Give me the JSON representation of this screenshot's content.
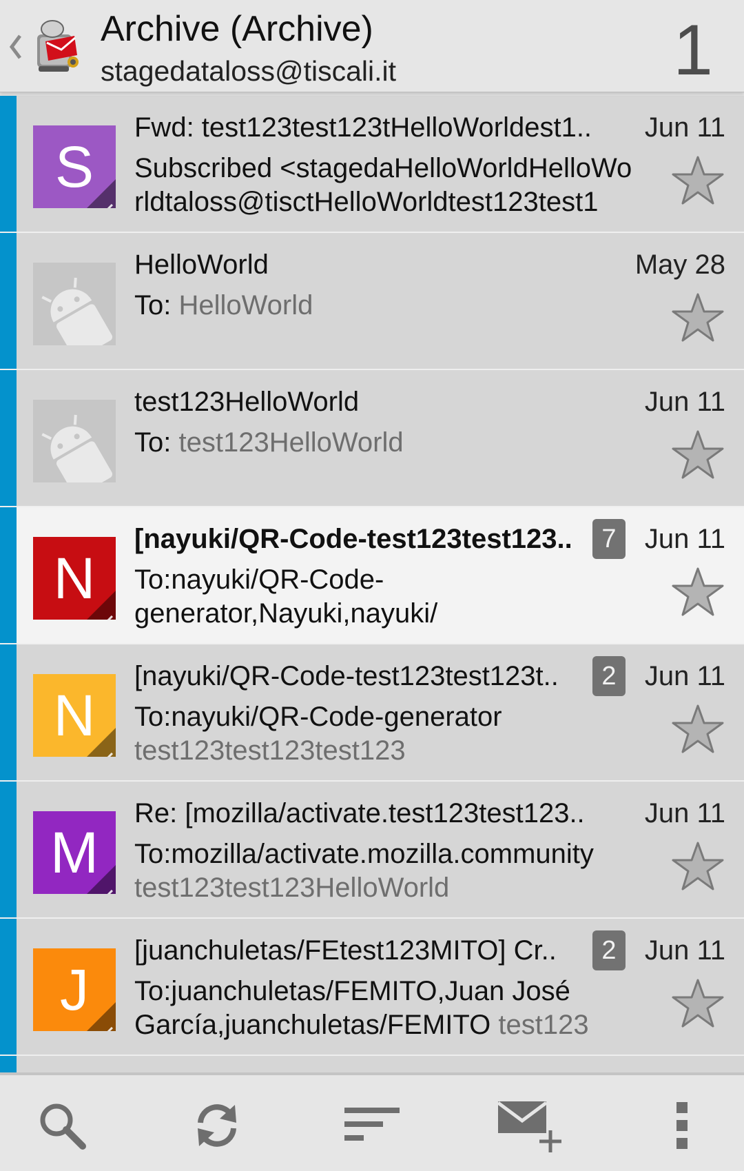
{
  "header": {
    "title": "Archive (Archive)",
    "account": "stagedataloss@tiscali.it",
    "unread_count": "1",
    "back_icon": "chevron-left-icon",
    "logo_icon": "k9-mail-logo"
  },
  "messages": [
    {
      "avatar_letter": "S",
      "avatar_color": "#9c58c4",
      "subject": "Fwd: test123test123tHelloWorldest1..",
      "date": "Jun 11",
      "preview_line1": "Subscribed <stagedaHelloWorldHelloWo",
      "preview_line2": "rldtaloss@tisctHelloWorldtest123test1",
      "starred": false
    },
    {
      "avatar_letter": "",
      "avatar_color": "#c6c6c6",
      "subject": "HelloWorld",
      "date": "May 28",
      "to_label": "To: ",
      "to_value": "HelloWorld",
      "starred": false
    },
    {
      "avatar_letter": "",
      "avatar_color": "#c6c6c6",
      "subject": "test123HelloWorld",
      "date": "Jun 11",
      "to_label": "To: ",
      "to_value": "test123HelloWorld",
      "starred": false
    },
    {
      "avatar_letter": "N",
      "avatar_color": "#c70d12",
      "subject": "[nayuki/QR-Code-test123test123..",
      "count": "7",
      "date": "Jun 11",
      "preview_line1": "To:nayuki/QR-Code-",
      "preview_line2": "generator,Nayuki,nayuki/",
      "unread": true,
      "starred": false
    },
    {
      "avatar_letter": "N",
      "avatar_color": "#fbb72c",
      "subject": "[nayuki/QR-Code-test123test123t..",
      "count": "2",
      "date": "Jun 11",
      "preview_line1": "To:nayuki/QR-Code-generator",
      "preview_line2": "test123test123test123",
      "starred": false
    },
    {
      "avatar_letter": "M",
      "avatar_color": "#9227c1",
      "subject": "Re: [mozilla/activate.test123test123..",
      "date": "Jun 11",
      "preview_line1": "To:mozilla/activate.mozilla.community",
      "preview_line2": "test123test123HelloWorld",
      "starred": false
    },
    {
      "avatar_letter": "J",
      "avatar_color": "#fb8a0c",
      "subject": "[juanchuletas/FEtest123MITO] Cr..",
      "count": "2",
      "date": "Jun 11",
      "preview_line1": "To:juanchuletas/FEMITO,Juan José",
      "preview_line2a": "García,juanchuletas/FEMITO",
      "preview_line2b": " test123",
      "starred": false
    }
  ],
  "toolbar": {
    "icons": [
      "search-icon",
      "refresh-icon",
      "sort-icon",
      "compose-icon",
      "overflow-menu-icon"
    ]
  },
  "colors": {
    "accent": "#0492cc",
    "row_read": "#d6d6d6",
    "row_unread": "#f3f3f3",
    "muted_text": "#6e6e6e"
  }
}
